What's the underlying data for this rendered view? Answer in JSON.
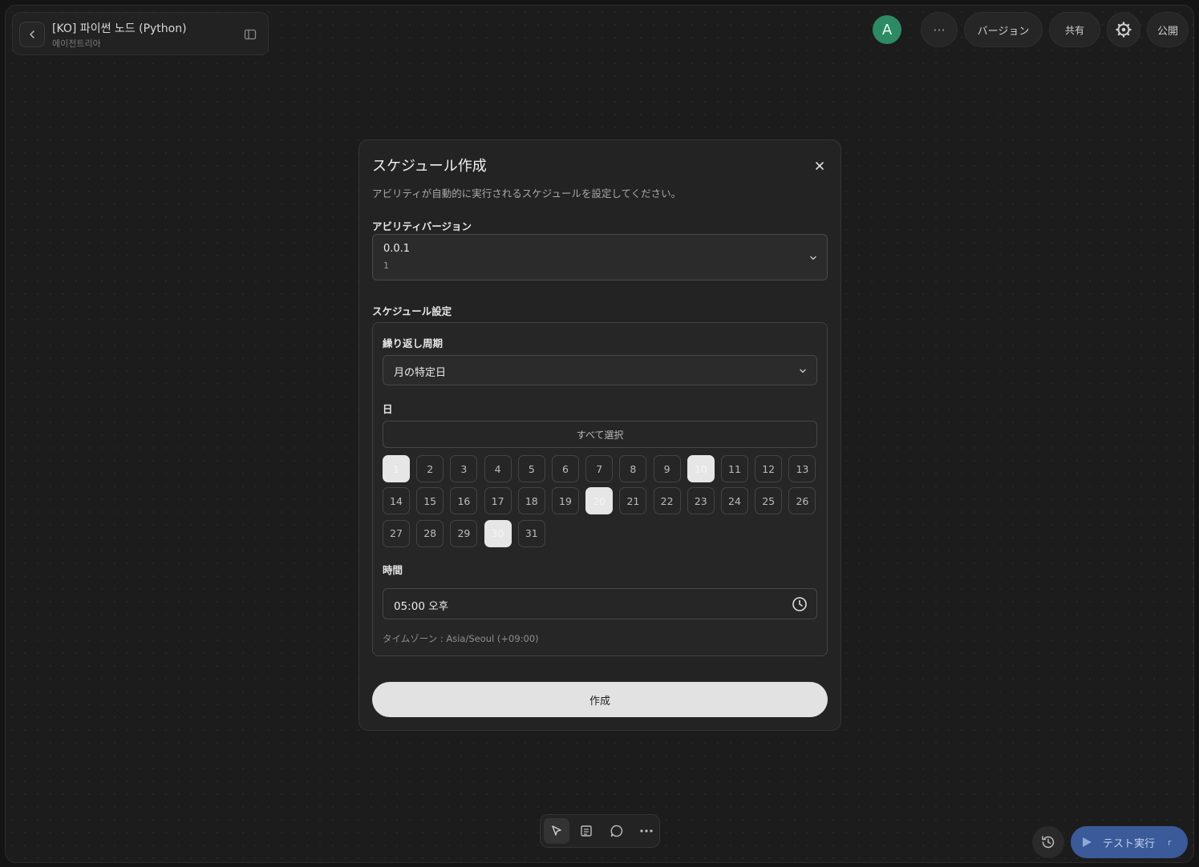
{
  "project": {
    "title": "[KO] 파이썬 노드 (Python)",
    "subtitle": "에이전트리아"
  },
  "topbar": {
    "avatar_letter": "A",
    "avatar_color": "#2d8a63",
    "more_label": "···",
    "version_label": "バージョン",
    "share_label": "共有",
    "publish_label": "公開"
  },
  "modal": {
    "title": "スケジュール作成",
    "description": "アビリティが自動的に実行されるスケジュールを設定してください。",
    "version_section_label": "アビリティバージョン",
    "version_select": {
      "value": "0.0.1",
      "sub": "1"
    },
    "schedule_section_label": "スケジュール設定",
    "repeat_label": "繰り返し周期",
    "repeat_value": "月の特定日",
    "day_label": "日",
    "select_all_label": "すべて選択",
    "days": [
      "1",
      "2",
      "3",
      "4",
      "5",
      "6",
      "7",
      "8",
      "9",
      "10",
      "11",
      "12",
      "13",
      "14",
      "15",
      "16",
      "17",
      "18",
      "19",
      "20",
      "21",
      "22",
      "23",
      "24",
      "25",
      "26",
      "27",
      "28",
      "29",
      "30",
      "31"
    ],
    "selected_days": [
      "1",
      "10",
      "20",
      "30"
    ],
    "time_label": "時間",
    "time_value": "05:00 오후",
    "timezone": "タイムゾーン : Asia/Seoul (+09:00)",
    "create_label": "作成"
  },
  "bottom": {
    "test_run_label": "テスト実行",
    "test_run_shortcut": "r",
    "accent_color": "#3a5a99"
  }
}
